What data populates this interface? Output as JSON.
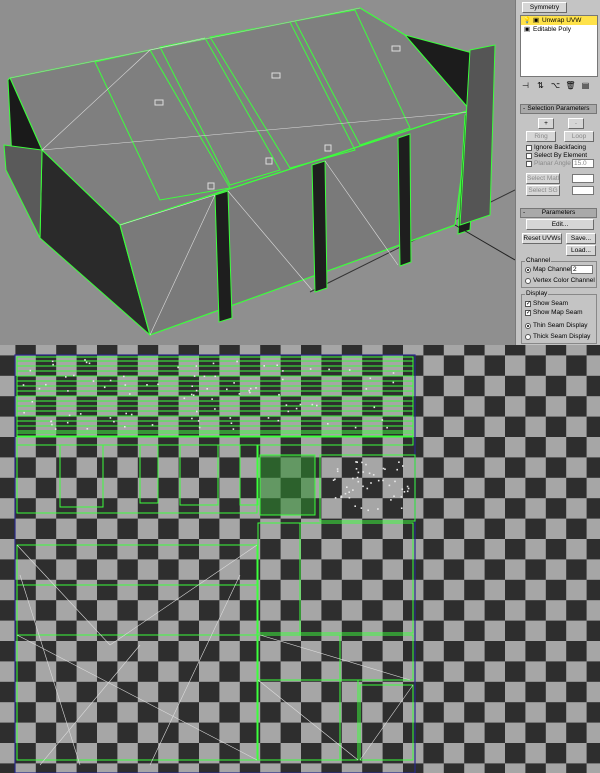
{
  "modifier_stack": {
    "symmetry_label": "Symmetry",
    "items": [
      {
        "label": "Unwrap UVW",
        "selected": true
      },
      {
        "label": "Editable Poly",
        "selected": false
      }
    ]
  },
  "stack_tools": [
    {
      "icon": "pin-stack-icon",
      "glyph": "⊣"
    },
    {
      "icon": "show-end-result-icon",
      "glyph": "⇅"
    },
    {
      "icon": "make-unique-icon",
      "glyph": "⌥"
    },
    {
      "icon": "remove-modifier-icon",
      "glyph": "🗑"
    },
    {
      "icon": "configure-modifier-sets-icon",
      "glyph": "▤"
    }
  ],
  "selection_parameters": {
    "title": "Selection Parameters",
    "plus_label": "+",
    "minus_label": "-",
    "ring_label": "Ring",
    "loop_label": "Loop",
    "ignore_backfacing": "Ignore Backfacing",
    "select_by_element": "Select By Element",
    "planar_angle_label": "Planar Angle",
    "planar_angle_value": "15.0",
    "select_matid_label": "Select MatID",
    "select_sg_label": "Select SG"
  },
  "parameters": {
    "title": "Parameters",
    "edit_label": "Edit...",
    "reset_label": "Reset UVWs",
    "save_label": "Save...",
    "load_label": "Load...",
    "channel_title": "Channel",
    "map_channel_label": "Map Channel:",
    "map_channel_value": "2",
    "vertex_color_label": "Vertex Color Channel",
    "display_title": "Display",
    "show_seam": "Show Seam",
    "show_map_seam": "Show Map Seam",
    "thin_seam": "Thin Seam Display",
    "thick_seam": "Thick Seam Display"
  },
  "colors": {
    "wire_green": "#3cff3c",
    "selected_item": "#ffe24a",
    "checker_light": "#a6a6a6",
    "checker_dark": "#2e2e2e",
    "viewport_bg": "#8f8f8f",
    "uv_border": "#2a2a8a"
  }
}
